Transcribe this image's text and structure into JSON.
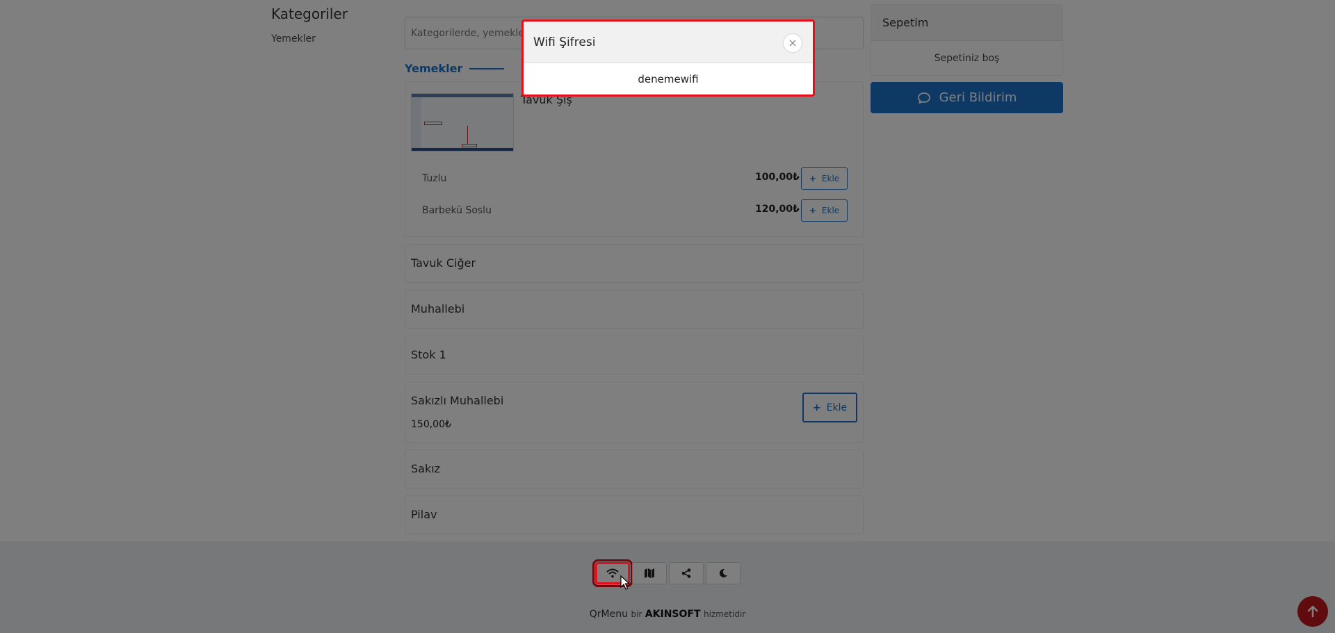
{
  "categories": {
    "title": "Kategoriler",
    "items": [
      "Yemekler"
    ]
  },
  "search": {
    "placeholder": "Kategorilerde, yemeklerde ara"
  },
  "section": {
    "title": "Yemekler"
  },
  "products": {
    "tavuk_sis": {
      "name": "Tavuk Şiş",
      "variants": [
        {
          "label": "Tuzlu",
          "price": "100,00₺",
          "button": "Ekle"
        },
        {
          "label": "Barbekü Soslu",
          "price": "120,00₺",
          "button": "Ekle"
        }
      ]
    },
    "tavuk_ciger": {
      "name": "Tavuk Ciğer"
    },
    "muhallebi": {
      "name": "Muhallebi"
    },
    "stok1": {
      "name": "Stok 1"
    },
    "sakizli": {
      "name": "Sakızlı Muhallebi",
      "price": "150,00₺",
      "button": "Ekle"
    },
    "sakiz": {
      "name": "Sakız"
    },
    "pilav": {
      "name": "Pilav"
    }
  },
  "cart": {
    "title": "Sepetim",
    "empty": "Sepetiniz boş"
  },
  "feedback": {
    "label": "Geri Bildirim"
  },
  "footer": {
    "icons": [
      "wifi-icon",
      "map-icon",
      "share-icon",
      "moon-icon"
    ],
    "credit_brand": "QrMenu",
    "credit_bir": "bir",
    "credit_company": "AKINSOFT",
    "credit_suffix": "hizmetidir"
  },
  "modal": {
    "title": "Wifi Şifresi",
    "body": "denemewifi",
    "close": "×"
  },
  "colors": {
    "primary": "#1a73c8",
    "highlight": "#e0111b",
    "to_top": "#c0181e"
  }
}
